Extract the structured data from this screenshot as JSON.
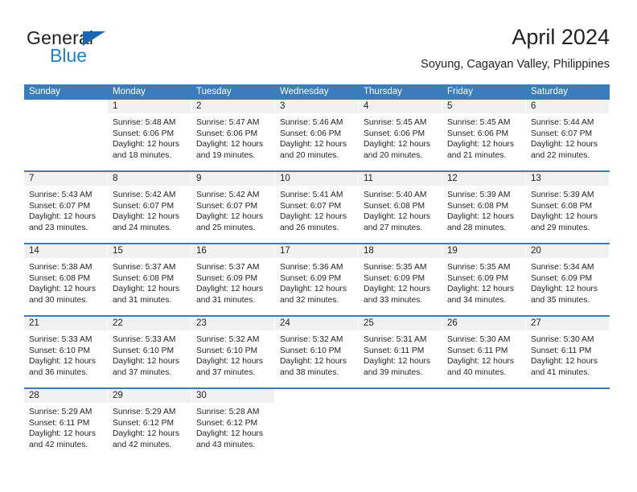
{
  "logo": {
    "word1": "General",
    "word2": "Blue",
    "triangle_color": "#1668b3",
    "word2_color": "#1b7fd4"
  },
  "header": {
    "title": "April 2024",
    "subtitle": "Soyung, Cagayan Valley, Philippines"
  },
  "theme": {
    "header_blue": "#3a7cbe",
    "daynum_band": "#f1f1f1",
    "text": "#231f20"
  },
  "weekdays": [
    "Sunday",
    "Monday",
    "Tuesday",
    "Wednesday",
    "Thursday",
    "Friday",
    "Saturday"
  ],
  "weeks": [
    [
      {
        "day": "",
        "blank": true,
        "lines": []
      },
      {
        "day": "1",
        "lines": [
          "Sunrise: 5:48 AM",
          "Sunset: 6:06 PM",
          "Daylight: 12 hours",
          "and 18 minutes."
        ]
      },
      {
        "day": "2",
        "lines": [
          "Sunrise: 5:47 AM",
          "Sunset: 6:06 PM",
          "Daylight: 12 hours",
          "and 19 minutes."
        ]
      },
      {
        "day": "3",
        "lines": [
          "Sunrise: 5:46 AM",
          "Sunset: 6:06 PM",
          "Daylight: 12 hours",
          "and 20 minutes."
        ]
      },
      {
        "day": "4",
        "lines": [
          "Sunrise: 5:45 AM",
          "Sunset: 6:06 PM",
          "Daylight: 12 hours",
          "and 20 minutes."
        ]
      },
      {
        "day": "5",
        "lines": [
          "Sunrise: 5:45 AM",
          "Sunset: 6:06 PM",
          "Daylight: 12 hours",
          "and 21 minutes."
        ]
      },
      {
        "day": "6",
        "lines": [
          "Sunrise: 5:44 AM",
          "Sunset: 6:07 PM",
          "Daylight: 12 hours",
          "and 22 minutes."
        ]
      }
    ],
    [
      {
        "day": "7",
        "lines": [
          "Sunrise: 5:43 AM",
          "Sunset: 6:07 PM",
          "Daylight: 12 hours",
          "and 23 minutes."
        ]
      },
      {
        "day": "8",
        "lines": [
          "Sunrise: 5:42 AM",
          "Sunset: 6:07 PM",
          "Daylight: 12 hours",
          "and 24 minutes."
        ]
      },
      {
        "day": "9",
        "lines": [
          "Sunrise: 5:42 AM",
          "Sunset: 6:07 PM",
          "Daylight: 12 hours",
          "and 25 minutes."
        ]
      },
      {
        "day": "10",
        "lines": [
          "Sunrise: 5:41 AM",
          "Sunset: 6:07 PM",
          "Daylight: 12 hours",
          "and 26 minutes."
        ]
      },
      {
        "day": "11",
        "lines": [
          "Sunrise: 5:40 AM",
          "Sunset: 6:08 PM",
          "Daylight: 12 hours",
          "and 27 minutes."
        ]
      },
      {
        "day": "12",
        "lines": [
          "Sunrise: 5:39 AM",
          "Sunset: 6:08 PM",
          "Daylight: 12 hours",
          "and 28 minutes."
        ]
      },
      {
        "day": "13",
        "lines": [
          "Sunrise: 5:39 AM",
          "Sunset: 6:08 PM",
          "Daylight: 12 hours",
          "and 29 minutes."
        ]
      }
    ],
    [
      {
        "day": "14",
        "lines": [
          "Sunrise: 5:38 AM",
          "Sunset: 6:08 PM",
          "Daylight: 12 hours",
          "and 30 minutes."
        ]
      },
      {
        "day": "15",
        "lines": [
          "Sunrise: 5:37 AM",
          "Sunset: 6:08 PM",
          "Daylight: 12 hours",
          "and 31 minutes."
        ]
      },
      {
        "day": "16",
        "lines": [
          "Sunrise: 5:37 AM",
          "Sunset: 6:09 PM",
          "Daylight: 12 hours",
          "and 31 minutes."
        ]
      },
      {
        "day": "17",
        "lines": [
          "Sunrise: 5:36 AM",
          "Sunset: 6:09 PM",
          "Daylight: 12 hours",
          "and 32 minutes."
        ]
      },
      {
        "day": "18",
        "lines": [
          "Sunrise: 5:35 AM",
          "Sunset: 6:09 PM",
          "Daylight: 12 hours",
          "and 33 minutes."
        ]
      },
      {
        "day": "19",
        "lines": [
          "Sunrise: 5:35 AM",
          "Sunset: 6:09 PM",
          "Daylight: 12 hours",
          "and 34 minutes."
        ]
      },
      {
        "day": "20",
        "lines": [
          "Sunrise: 5:34 AM",
          "Sunset: 6:09 PM",
          "Daylight: 12 hours",
          "and 35 minutes."
        ]
      }
    ],
    [
      {
        "day": "21",
        "lines": [
          "Sunrise: 5:33 AM",
          "Sunset: 6:10 PM",
          "Daylight: 12 hours",
          "and 36 minutes."
        ]
      },
      {
        "day": "22",
        "lines": [
          "Sunrise: 5:33 AM",
          "Sunset: 6:10 PM",
          "Daylight: 12 hours",
          "and 37 minutes."
        ]
      },
      {
        "day": "23",
        "lines": [
          "Sunrise: 5:32 AM",
          "Sunset: 6:10 PM",
          "Daylight: 12 hours",
          "and 37 minutes."
        ]
      },
      {
        "day": "24",
        "lines": [
          "Sunrise: 5:32 AM",
          "Sunset: 6:10 PM",
          "Daylight: 12 hours",
          "and 38 minutes."
        ]
      },
      {
        "day": "25",
        "lines": [
          "Sunrise: 5:31 AM",
          "Sunset: 6:11 PM",
          "Daylight: 12 hours",
          "and 39 minutes."
        ]
      },
      {
        "day": "26",
        "lines": [
          "Sunrise: 5:30 AM",
          "Sunset: 6:11 PM",
          "Daylight: 12 hours",
          "and 40 minutes."
        ]
      },
      {
        "day": "27",
        "lines": [
          "Sunrise: 5:30 AM",
          "Sunset: 6:11 PM",
          "Daylight: 12 hours",
          "and 41 minutes."
        ]
      }
    ],
    [
      {
        "day": "28",
        "lines": [
          "Sunrise: 5:29 AM",
          "Sunset: 6:11 PM",
          "Daylight: 12 hours",
          "and 42 minutes."
        ]
      },
      {
        "day": "29",
        "lines": [
          "Sunrise: 5:29 AM",
          "Sunset: 6:12 PM",
          "Daylight: 12 hours",
          "and 42 minutes."
        ]
      },
      {
        "day": "30",
        "lines": [
          "Sunrise: 5:28 AM",
          "Sunset: 6:12 PM",
          "Daylight: 12 hours",
          "and 43 minutes."
        ]
      },
      {
        "day": "",
        "blank": true,
        "lines": []
      },
      {
        "day": "",
        "blank": true,
        "lines": []
      },
      {
        "day": "",
        "blank": true,
        "lines": []
      },
      {
        "day": "",
        "blank": true,
        "lines": []
      }
    ]
  ]
}
